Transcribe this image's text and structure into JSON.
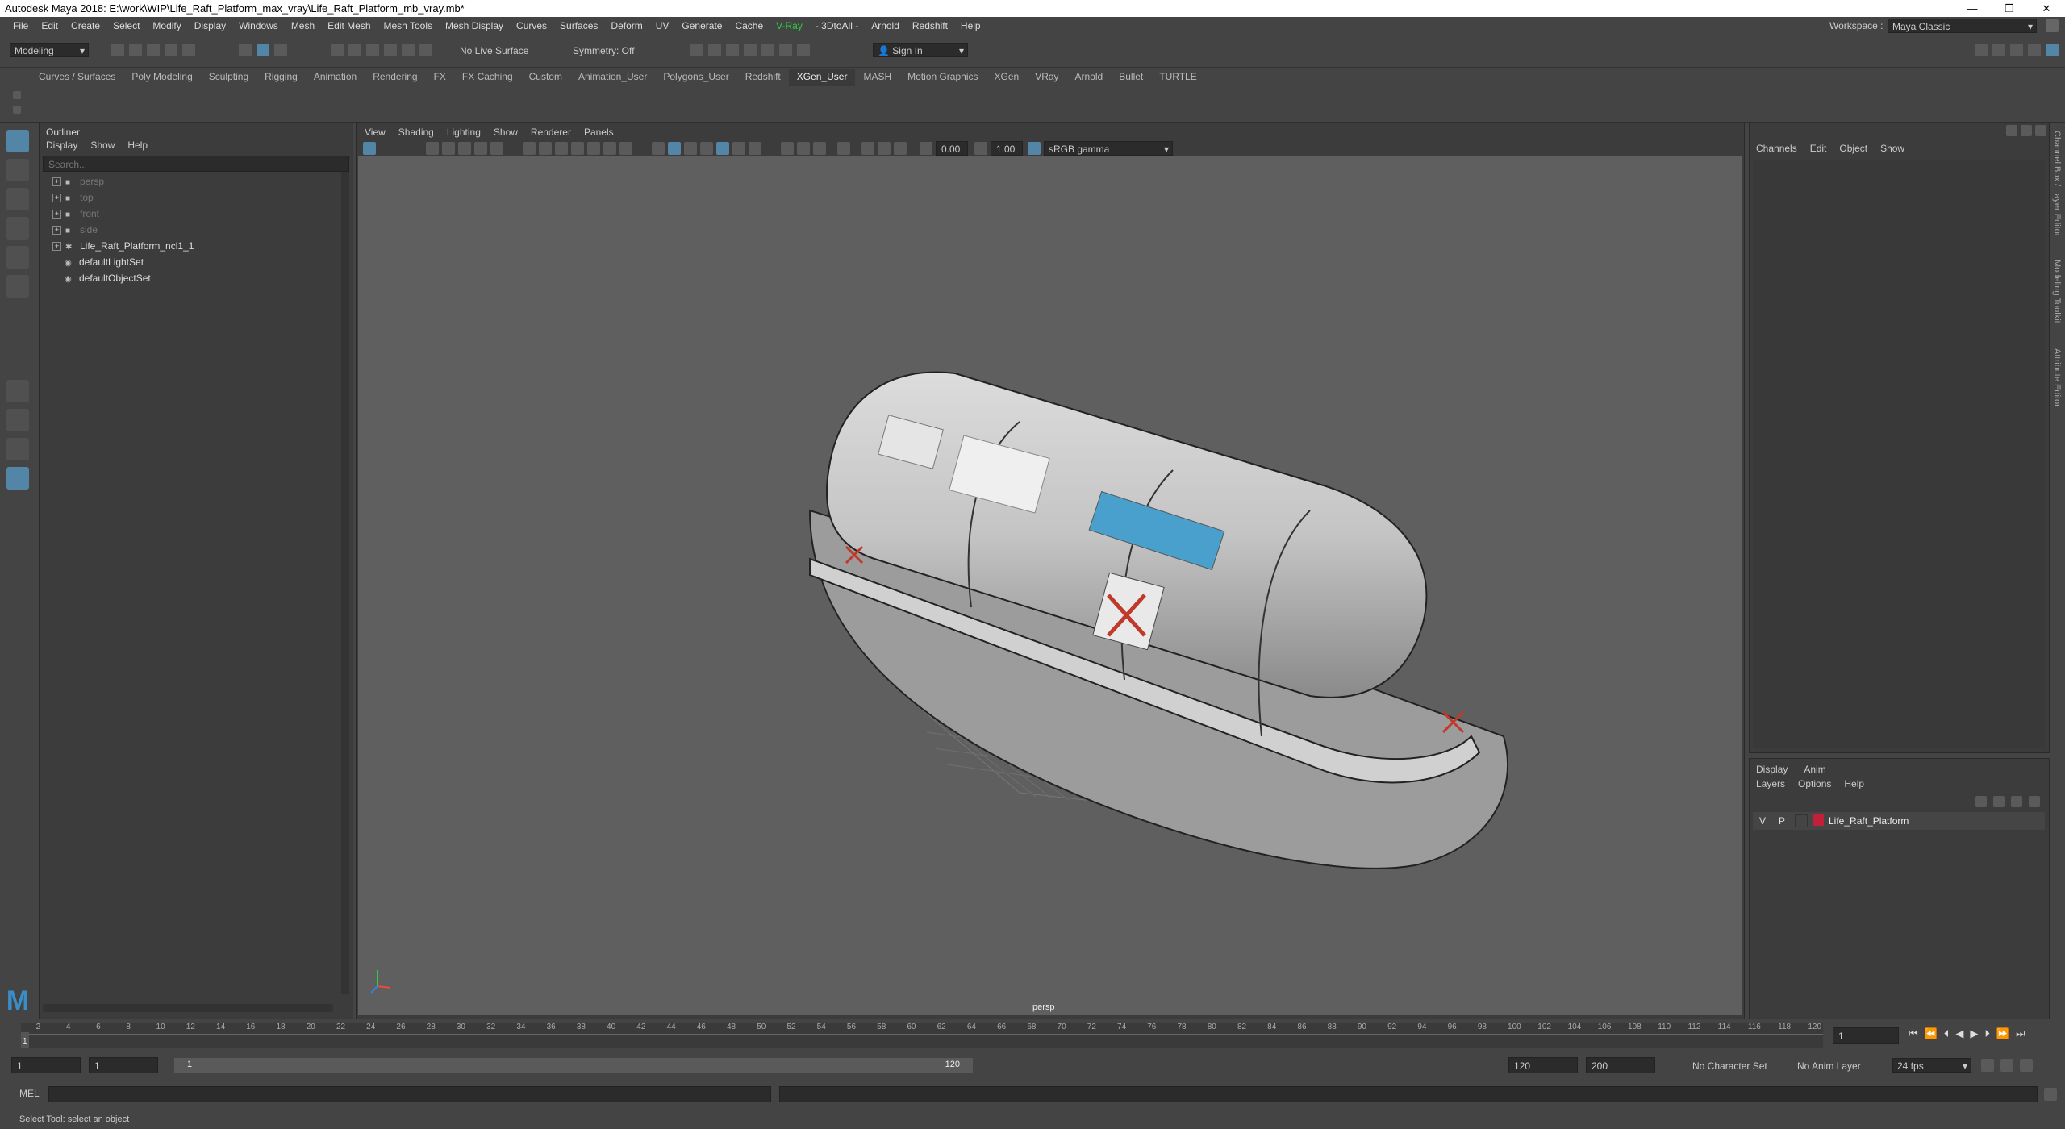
{
  "window": {
    "title": "Autodesk Maya 2018: E:\\work\\WIP\\Life_Raft_Platform_max_vray\\Life_Raft_Platform_mb_vray.mb*",
    "minimize": "—",
    "restore": "❐",
    "close": "✕"
  },
  "menubar": {
    "items": [
      "File",
      "Edit",
      "Create",
      "Select",
      "Modify",
      "Display",
      "Windows",
      "Mesh",
      "Edit Mesh",
      "Mesh Tools",
      "Mesh Display",
      "Curves",
      "Surfaces",
      "Deform",
      "UV",
      "Generate",
      "Cache",
      "V-Ray",
      "- 3DtoAll -",
      "Arnold",
      "Redshift",
      "Help"
    ],
    "workspace_label": "Workspace :",
    "workspace_value": "Maya Classic"
  },
  "statusline": {
    "mode": "Modeling",
    "live_surface": "No Live Surface",
    "symmetry": "Symmetry: Off",
    "sign_in": "Sign In"
  },
  "shelf_tabs": [
    "Curves / Surfaces",
    "Poly Modeling",
    "Sculpting",
    "Rigging",
    "Animation",
    "Rendering",
    "FX",
    "FX Caching",
    "Custom",
    "Animation_User",
    "Polygons_User",
    "Redshift",
    "XGen_User",
    "MASH",
    "Motion Graphics",
    "XGen",
    "VRay",
    "Arnold",
    "Bullet",
    "TURTLE"
  ],
  "active_shelf_tab": "XGen_User",
  "outliner": {
    "title": "Outliner",
    "menu": [
      "Display",
      "Show",
      "Help"
    ],
    "search_placeholder": "Search...",
    "items": [
      {
        "label": "persp",
        "dim": true
      },
      {
        "label": "top",
        "dim": true
      },
      {
        "label": "front",
        "dim": true
      },
      {
        "label": "side",
        "dim": true
      },
      {
        "label": "Life_Raft_Platform_ncl1_1",
        "dim": false
      },
      {
        "label": "defaultLightSet",
        "dim": false
      },
      {
        "label": "defaultObjectSet",
        "dim": false
      }
    ]
  },
  "viewport": {
    "menu": [
      "View",
      "Shading",
      "Lighting",
      "Show",
      "Renderer",
      "Panels"
    ],
    "exposure": "0.00",
    "gamma": "1.00",
    "colorspace": "sRGB gamma",
    "camera_label": "persp"
  },
  "channel_box": {
    "menu": [
      "Channels",
      "Edit",
      "Object",
      "Show"
    ],
    "side_tabs": [
      "Channel Box / Layer Editor",
      "Modeling Toolkit",
      "Attribute Editor"
    ]
  },
  "layer_editor": {
    "tabs": [
      "Display",
      "Anim"
    ],
    "menu": [
      "Layers",
      "Options",
      "Help"
    ],
    "layer": {
      "v": "V",
      "p": "P",
      "name": "Life_Raft_Platform",
      "color": "#c0203a"
    }
  },
  "timeline": {
    "ticks": [
      "2",
      "4",
      "6",
      "8",
      "10",
      "12",
      "14",
      "16",
      "18",
      "20",
      "22",
      "24",
      "26",
      "28",
      "30",
      "32",
      "34",
      "36",
      "38",
      "40",
      "42",
      "44",
      "46",
      "48",
      "50",
      "52",
      "54",
      "56",
      "58",
      "60",
      "62",
      "64",
      "66",
      "68",
      "70",
      "72",
      "74",
      "76",
      "78",
      "80",
      "82",
      "84",
      "86",
      "88",
      "90",
      "92",
      "94",
      "96",
      "98",
      "100",
      "102",
      "104",
      "106",
      "108",
      "110",
      "112",
      "114",
      "116",
      "118",
      "120"
    ],
    "current_frame_marker": "1",
    "current_frame_field": "1"
  },
  "range": {
    "start": "1",
    "playback_start": "1",
    "slider_start": "1",
    "slider_end": "120",
    "playback_end": "120",
    "end": "200",
    "character_set": "No Character Set",
    "anim_layer": "No Anim Layer",
    "fps": "24 fps"
  },
  "command": {
    "label": "MEL",
    "help": "Select Tool: select an object"
  },
  "colors": {
    "background": "#444444",
    "panel": "#3c3c3c",
    "viewport": "#5f5f5f",
    "accent": "#5285a6",
    "vray_green": "#2ecc40"
  }
}
